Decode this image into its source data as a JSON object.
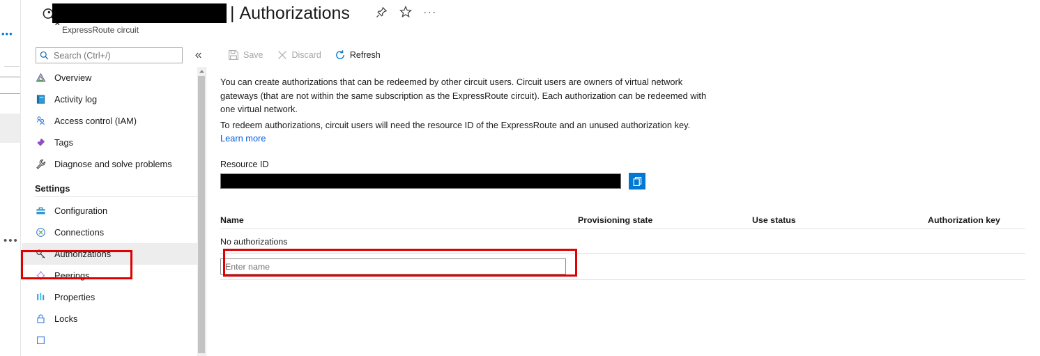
{
  "background_blade": {
    "overflow_menu_top": "•••",
    "overflow_menu_selected": "•••"
  },
  "header": {
    "resource_name_redacted": "",
    "separator": "|",
    "page_title": "Authorizations",
    "resource_type": "ExpressRoute circuit",
    "resource_icon": "key-icon",
    "actions": [
      {
        "name": "pin-icon",
        "tooltip": "Pin"
      },
      {
        "name": "favorite-star-icon",
        "tooltip": "Favorite"
      },
      {
        "name": "more-menu-icon",
        "label": "···"
      }
    ]
  },
  "search": {
    "placeholder": "Search (Ctrl+/)",
    "value": "",
    "icon": "search-icon",
    "collapse_icon": "double-chevron-left-icon"
  },
  "toolbar": {
    "items": [
      {
        "label": "Save",
        "icon": "save-disk-icon",
        "enabled": false
      },
      {
        "label": "Discard",
        "icon": "close-x-icon",
        "enabled": false
      },
      {
        "label": "Refresh",
        "icon": "refresh-circle-icon",
        "enabled": true
      }
    ]
  },
  "sidebar": {
    "items": [
      {
        "label": "Overview",
        "icon": "overview-triangle-icon",
        "selected": false
      },
      {
        "label": "Activity log",
        "icon": "activity-log-book-icon",
        "selected": false
      },
      {
        "label": "Access control (IAM)",
        "icon": "access-control-people-icon",
        "selected": false
      },
      {
        "label": "Tags",
        "icon": "tag-icon",
        "selected": false
      },
      {
        "label": "Diagnose and solve problems",
        "icon": "wrench-icon",
        "selected": false
      }
    ],
    "group_label": "Settings",
    "settings_items": [
      {
        "label": "Configuration",
        "icon": "configuration-toolbox-icon",
        "selected": false
      },
      {
        "label": "Connections",
        "icon": "connections-circle-icon",
        "selected": false
      },
      {
        "label": "Authorizations",
        "icon": "key-icon",
        "selected": true
      },
      {
        "label": "Peerings",
        "icon": "peerings-node-icon",
        "selected": false
      },
      {
        "label": "Properties",
        "icon": "properties-bars-icon",
        "selected": false
      },
      {
        "label": "Locks",
        "icon": "lock-icon",
        "selected": false
      }
    ],
    "scrollbar": {
      "up_arrow_icon": "chevron-up-icon"
    }
  },
  "content": {
    "paragraph_1": "You can create authorizations that can be redeemed by other circuit users. Circuit users are owners of virtual network gateways (that are not within the same subscription as the ExpressRoute circuit). Each authorization can be redeemed with one virtual network.",
    "paragraph_2": "To redeem authorizations, circuit users will need the resource ID of the ExpressRoute and an unused authorization key.",
    "learn_more": "Learn more",
    "resource_id_label": "Resource ID",
    "resource_id_value": "",
    "copy_button": {
      "icon": "copy-pages-icon",
      "color": "#0078d4"
    },
    "table": {
      "columns": [
        "Name",
        "Provisioning state",
        "Use status",
        "Authorization key"
      ],
      "empty_message": "No authorizations",
      "new_row": {
        "name_placeholder": "Enter name",
        "name_value": "",
        "provisioning_state": "",
        "use_status": "",
        "authorization_key": ""
      }
    }
  },
  "annotations": {
    "highlight_color": "#e00000",
    "boxes": [
      {
        "name": "sidebar-authorizations-highlight"
      },
      {
        "name": "enter-name-input-highlight"
      }
    ]
  }
}
